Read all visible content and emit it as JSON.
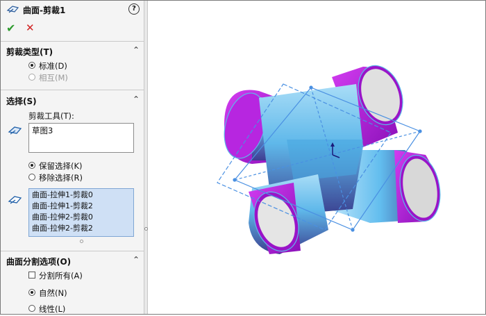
{
  "title": "曲面-剪裁1",
  "help_label": "?",
  "ok_label": "✔",
  "cancel_label": "✕",
  "trim_type": {
    "header": "剪裁类型(T)",
    "options": [
      {
        "label": "标准(D)",
        "selected": true,
        "enabled": true
      },
      {
        "label": "相互(M)",
        "selected": false,
        "enabled": false
      }
    ]
  },
  "selection": {
    "header": "选择(S)",
    "trim_tool_label": "剪裁工具(T):",
    "trim_tool_value": "草图3",
    "keep_remove": [
      {
        "label": "保留选择(K)",
        "selected": true
      },
      {
        "label": "移除选择(R)",
        "selected": false
      }
    ],
    "faces": [
      "曲面-拉伸1-剪裁0",
      "曲面-拉伸1-剪裁2",
      "曲面-拉伸2-剪裁0",
      "曲面-拉伸2-剪裁2"
    ]
  },
  "split_options": {
    "header": "曲面分割选项(O)",
    "split_all_label": "分割所有(A)",
    "split_all_checked": false,
    "modes": [
      {
        "label": "自然(N)",
        "selected": true
      },
      {
        "label": "线性(L)",
        "selected": false
      }
    ]
  },
  "colors": {
    "accent_pipe_end": "#b020d8",
    "accent_pipe_body": "#5fb8ea",
    "sketch_line": "#4a90e2"
  }
}
